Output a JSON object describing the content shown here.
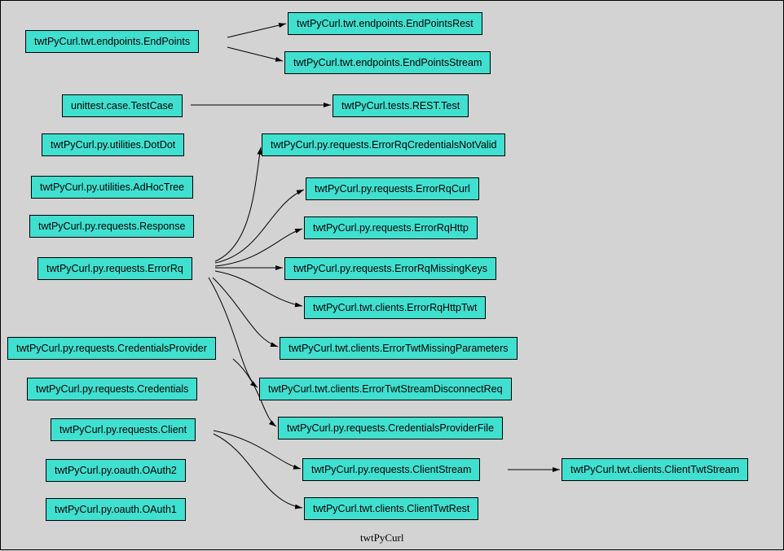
{
  "title": "twtPyCurl",
  "nodes": {
    "endpoints": "twtPyCurl.twt.endpoints.EndPoints",
    "endpointsRest": "twtPyCurl.twt.endpoints.EndPointsRest",
    "endpointsStream": "twtPyCurl.twt.endpoints.EndPointsStream",
    "testcase": "unittest.case.TestCase",
    "restTest": "twtPyCurl.tests.REST.Test",
    "dotdot": "twtPyCurl.py.utilities.DotDot",
    "adhoctree": "twtPyCurl.py.utilities.AdHocTree",
    "response": "twtPyCurl.py.requests.Response",
    "errorRq": "twtPyCurl.py.requests.ErrorRq",
    "errCredNotValid": "twtPyCurl.py.requests.ErrorRqCredentialsNotValid",
    "errCurl": "twtPyCurl.py.requests.ErrorRqCurl",
    "errHttp": "twtPyCurl.py.requests.ErrorRqHttp",
    "errMissingKeys": "twtPyCurl.py.requests.ErrorRqMissingKeys",
    "errHttpTwt": "twtPyCurl.twt.clients.ErrorRqHttpTwt",
    "errTwtMissingParams": "twtPyCurl.twt.clients.ErrorTwtMissingParameters",
    "errTwtStreamDisc": "twtPyCurl.twt.clients.ErrorTwtStreamDisconnectReq",
    "credProvider": "twtPyCurl.py.requests.CredentialsProvider",
    "credentials": "twtPyCurl.py.requests.Credentials",
    "client": "twtPyCurl.py.requests.Client",
    "oauth2": "twtPyCurl.py.oauth.OAuth2",
    "oauth1": "twtPyCurl.py.oauth.OAuth1",
    "credProviderFile": "twtPyCurl.py.requests.CredentialsProviderFile",
    "clientStream": "twtPyCurl.py.requests.ClientStream",
    "clientTwtRest": "twtPyCurl.twt.clients.ClientTwtRest",
    "clientTwtStream": "twtPyCurl.twt.clients.ClientTwtStream"
  },
  "chart_data": {
    "type": "diagram",
    "title": "twtPyCurl",
    "edges": [
      {
        "from": "endpoints",
        "to": "endpointsRest"
      },
      {
        "from": "endpoints",
        "to": "endpointsStream"
      },
      {
        "from": "testcase",
        "to": "restTest"
      },
      {
        "from": "errorRq",
        "to": "errCredNotValid"
      },
      {
        "from": "errorRq",
        "to": "errCurl"
      },
      {
        "from": "errorRq",
        "to": "errHttp"
      },
      {
        "from": "errorRq",
        "to": "errMissingKeys"
      },
      {
        "from": "errorRq",
        "to": "errHttpTwt"
      },
      {
        "from": "errorRq",
        "to": "errTwtMissingParams"
      },
      {
        "from": "errorRq",
        "to": "errTwtStreamDisc"
      },
      {
        "from": "credProvider",
        "to": "credProviderFile"
      },
      {
        "from": "client",
        "to": "clientStream"
      },
      {
        "from": "client",
        "to": "clientTwtRest"
      },
      {
        "from": "clientStream",
        "to": "clientTwtStream"
      }
    ]
  }
}
